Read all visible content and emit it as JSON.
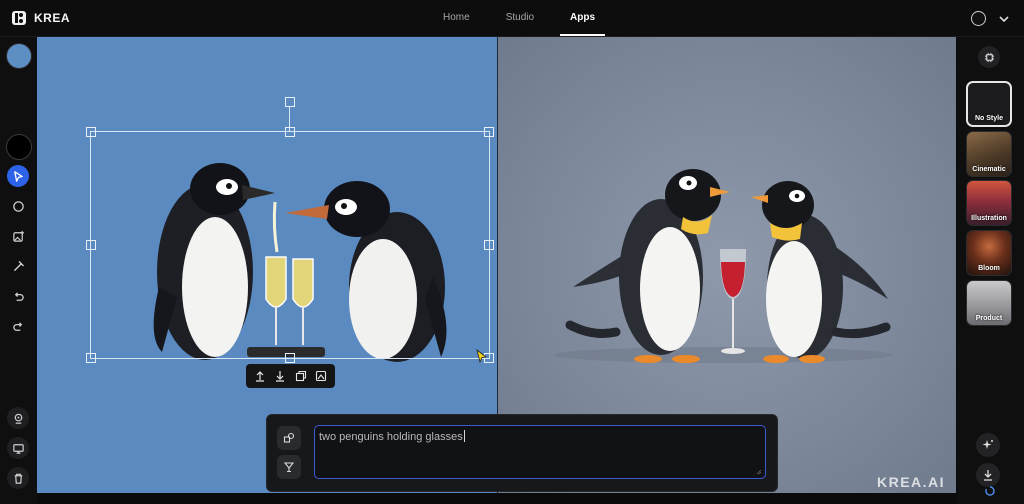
{
  "app": {
    "brand": "KREA"
  },
  "nav": {
    "items": [
      "Home",
      "Studio",
      "Apps"
    ],
    "active_index": 2
  },
  "colors": {
    "accent": "#2d63e8",
    "left_canvas_bg": "#5b8ac0",
    "right_canvas_bg": "#808c9e",
    "selected_color": "#5e8fc4"
  },
  "styles": [
    {
      "label": "No Style",
      "selected": true
    },
    {
      "label": "Cinematic",
      "selected": false
    },
    {
      "label": "Illustration",
      "selected": false
    },
    {
      "label": "Bloom",
      "selected": false
    },
    {
      "label": "Product",
      "selected": false
    }
  ],
  "prompt": {
    "text": "two penguins holding glasses"
  },
  "watermark": "KREA.AI"
}
